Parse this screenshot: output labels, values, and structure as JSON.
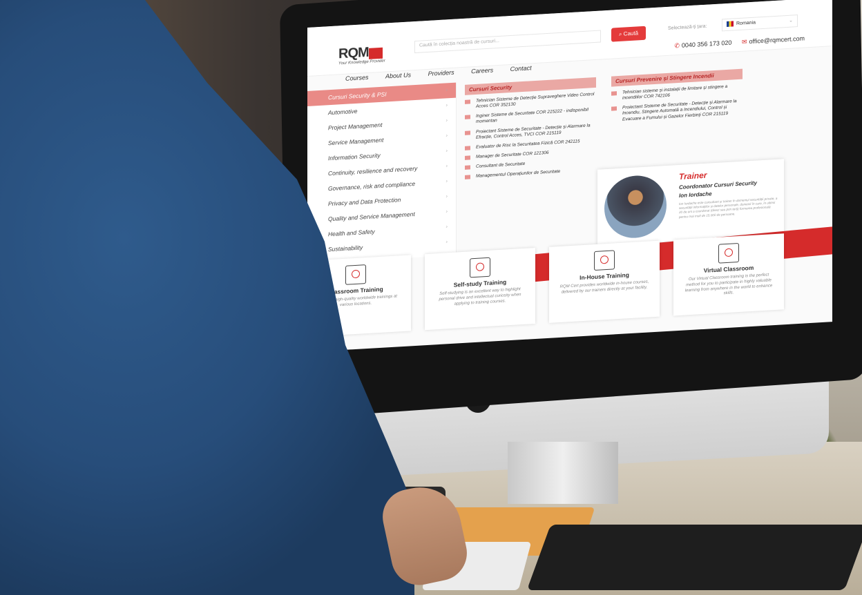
{
  "site": {
    "logo_text": "RQM",
    "tagline": "Your Knowledge Provider",
    "search_placeholder": "Caută în colecția noastră de cursuri...",
    "search_button": "Caută",
    "country_label": "Selectează-ți țara:",
    "country_value": "Romania",
    "phone": "0040 356 173 020",
    "email": "office@rqmcert.com"
  },
  "nav": [
    "Courses",
    "About Us",
    "Providers",
    "Careers",
    "Contact"
  ],
  "menu": [
    "Cursuri Security & PSI",
    "Automotive",
    "Project Management",
    "Service Management",
    "Information Security",
    "Continuity, resilience and recovery",
    "Governance, risk and compliance",
    "Privacy and Data Protection",
    "Quality and Service Management",
    "Health and Safety",
    "Sustainability"
  ],
  "col1": {
    "title": "Cursuri Security",
    "items": [
      "Tehnician Sisteme de Detecție Supraveghere Video Control Acces COR 352130",
      "Inginer Sisteme de Securitate COR 215222 - indisponibil momentan",
      "Proiectant Sisteme de Securitate - Detecție și Alarmare la Efracție, Control Acces, TVCI COR 215119",
      "Evaluator de Risc la Securitatea Fizică COR 242115",
      "Manager de Securitate COR 121306",
      "Consultant de Securitate",
      "Managementul Operațiunilor de Securitate"
    ]
  },
  "col2": {
    "title": "Cursuri Prevenire și Stingere Incendii",
    "items": [
      "Tehnician sisteme și instalații de limitare și stingere a incendiilor COR 742106",
      "Proiectant Sisteme de Securitate - Detecție și Alarmare la Incendiu, Stingere Automată a Incendiului, Control și Evacuare a Fumului și Gazelor Fierbinți COR 215119"
    ]
  },
  "trainer": {
    "heading": "Trainer",
    "role": "Coordonator Cursuri Security",
    "name": "Ion Iordache",
    "bio": "Ion Iordache este consultant și trainer în domeniul securității private, a securității informațiilor și datelor personale, domenii în care, în ultimii 20 de ani a coordonat (direct sau prin terți) formarea profesională pentru mai mult de 15.000 de persoane."
  },
  "cards": [
    {
      "title": "Classroom Training",
      "desc": "We deliver high-quality worldwide trainings at various locations."
    },
    {
      "title": "Self-study Training",
      "desc": "Self-studying is an excellent way to highlight personal drive and intellectual curiosity when applying to training courses."
    },
    {
      "title": "In-House Training",
      "desc": "RQM Cert provides worldwide in-house courses, delivered by our trainers directly at your facility."
    },
    {
      "title": "Virtual Classroom",
      "desc": "Our Virtual Classroom training is the perfect method for you to participate in highly valuable learning from anywhere in the world to enhance skills."
    }
  ],
  "colors": {
    "brand_red": "#d52b2b",
    "menu_active": "#e98a86"
  }
}
